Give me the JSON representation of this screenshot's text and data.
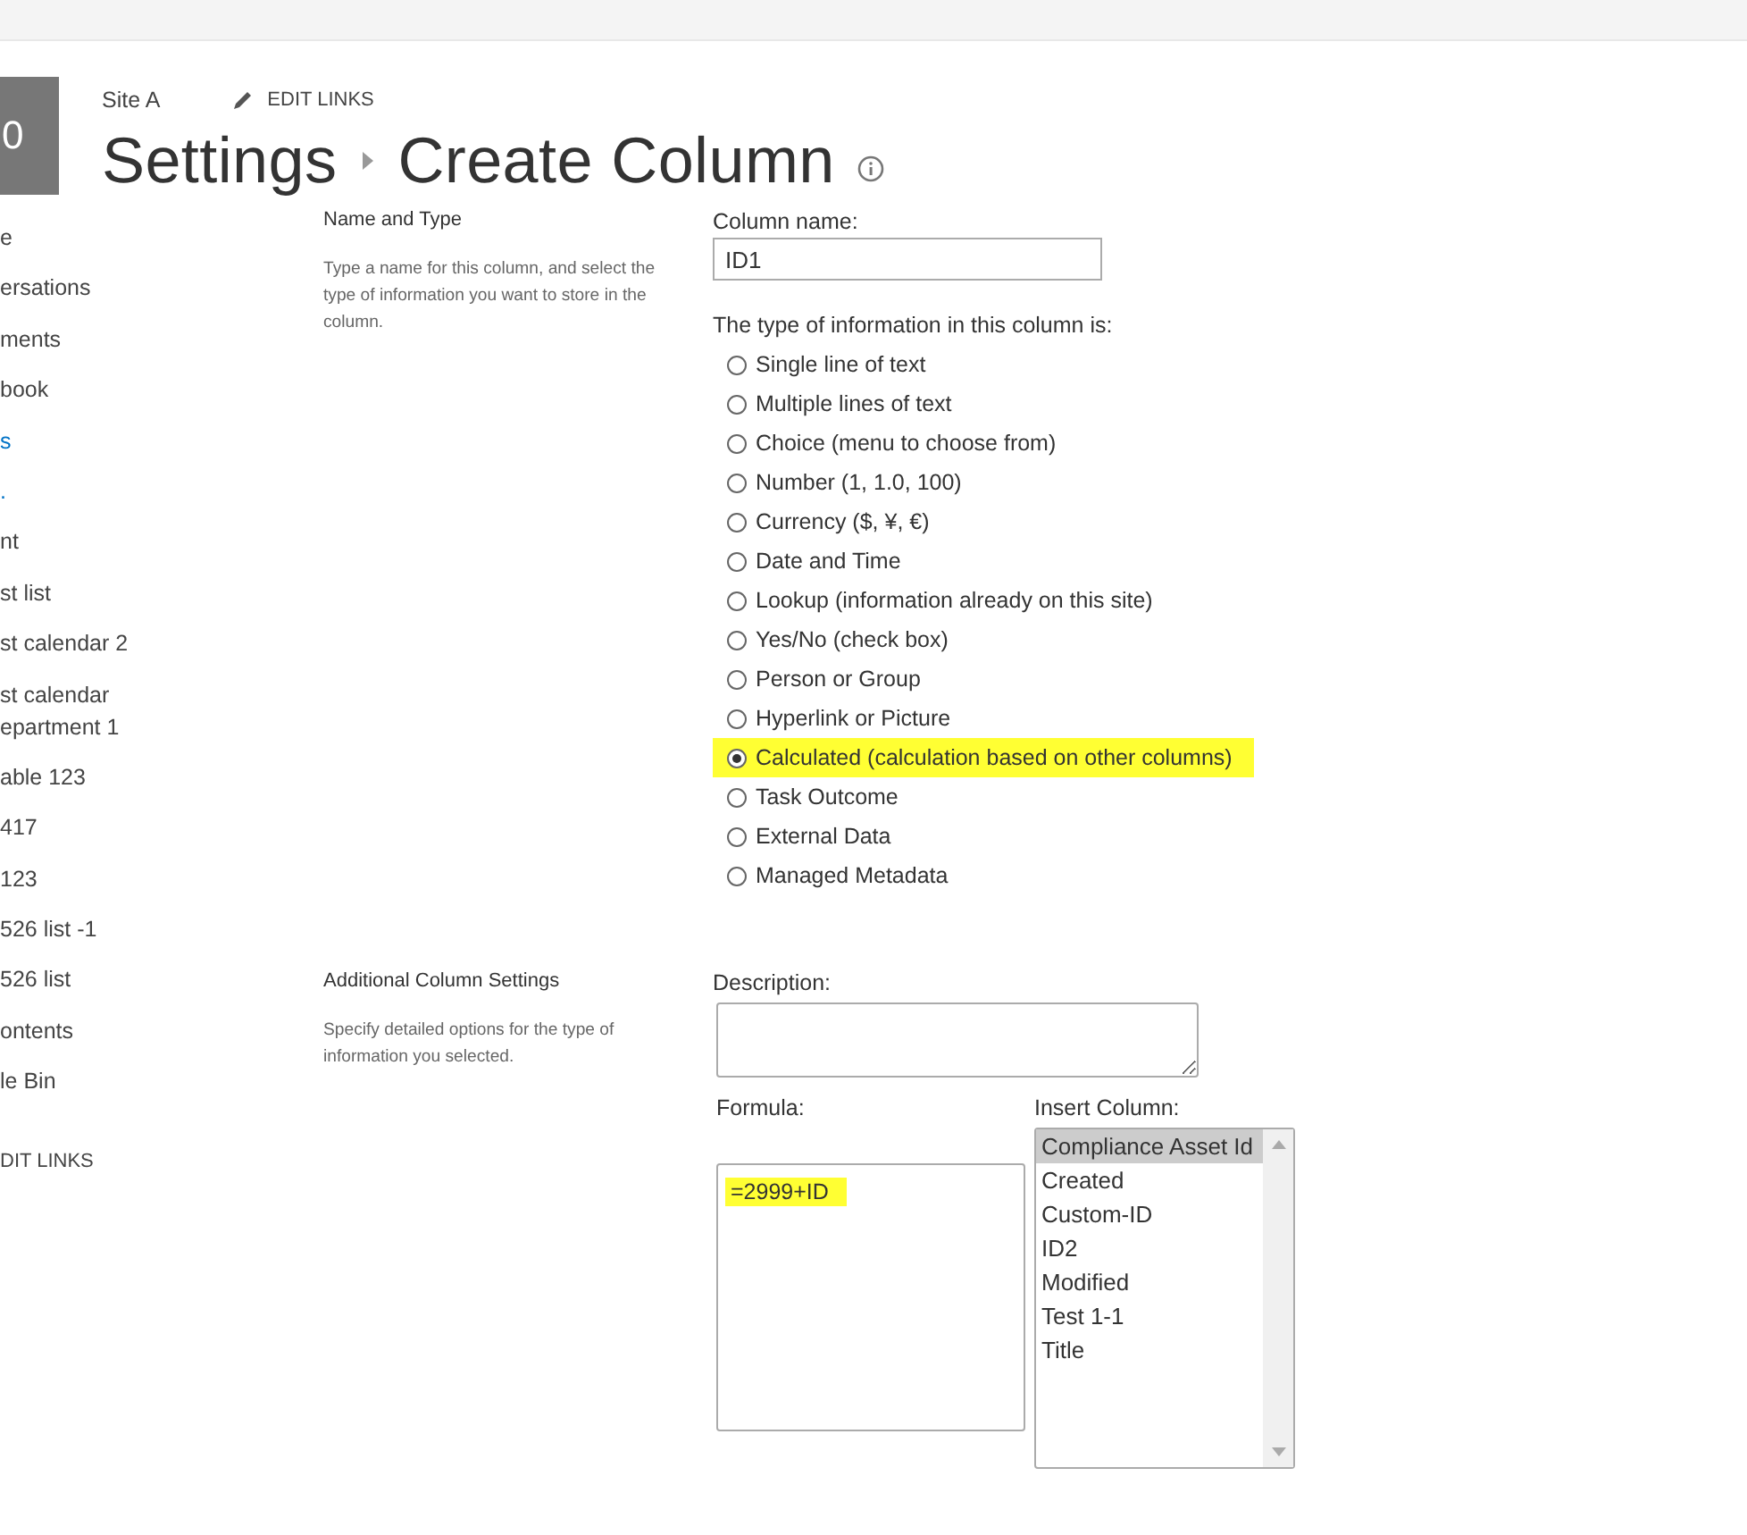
{
  "header": {
    "logo_text": "0",
    "site_name": "Site A",
    "edit_links": "EDIT LINKS",
    "breadcrumb": [
      "Settings",
      "Create Column"
    ]
  },
  "sidebar": {
    "items": [
      {
        "label": "e"
      },
      {
        "label": "ersations"
      },
      {
        "label": "ments"
      },
      {
        "label": "book"
      },
      {
        "label": "s",
        "link": true
      },
      {
        "label": ".",
        "link": true
      },
      {
        "label": "nt"
      },
      {
        "label": "st list"
      },
      {
        "label": "st calendar 2"
      },
      {
        "label": "st calendar\nepartment 1"
      },
      {
        "label": "able 123"
      },
      {
        "label": "417"
      },
      {
        "label": "123"
      },
      {
        "label": "526 list -1"
      },
      {
        "label": "526 list"
      },
      {
        "label": "ontents"
      },
      {
        "label": "le Bin"
      }
    ],
    "edit_links": "DIT LINKS"
  },
  "sections": [
    {
      "kind": "name_type",
      "title": "Name and Type",
      "description": "Type a name for this column, and select the type of information you want to store in the column.",
      "column_name_label": "Column name:",
      "column_name_value": "ID1",
      "type_label": "The type of information in this column is:",
      "options": [
        {
          "label": "Single line of text",
          "selected": false,
          "highlighted": false
        },
        {
          "label": "Multiple lines of text",
          "selected": false,
          "highlighted": false
        },
        {
          "label": "Choice (menu to choose from)",
          "selected": false,
          "highlighted": false
        },
        {
          "label": "Number (1, 1.0, 100)",
          "selected": false,
          "highlighted": false
        },
        {
          "label": "Currency ($, ¥, €)",
          "selected": false,
          "highlighted": false
        },
        {
          "label": "Date and Time",
          "selected": false,
          "highlighted": false
        },
        {
          "label": "Lookup (information already on this site)",
          "selected": false,
          "highlighted": false
        },
        {
          "label": "Yes/No (check box)",
          "selected": false,
          "highlighted": false
        },
        {
          "label": "Person or Group",
          "selected": false,
          "highlighted": false
        },
        {
          "label": "Hyperlink or Picture",
          "selected": false,
          "highlighted": false
        },
        {
          "label": "Calculated (calculation based on other columns)",
          "selected": true,
          "highlighted": true
        },
        {
          "label": "Task Outcome",
          "selected": false,
          "highlighted": false
        },
        {
          "label": "External Data",
          "selected": false,
          "highlighted": false
        },
        {
          "label": "Managed Metadata",
          "selected": false,
          "highlighted": false
        }
      ]
    },
    {
      "kind": "additional",
      "title": "Additional Column Settings",
      "description": "Specify detailed options for the type of information you selected.",
      "description_label": "Description:",
      "formula_label": "Formula:",
      "formula_value": "=2999+ID",
      "formula_highlighted": true,
      "insert_label": "Insert Column:",
      "columns": [
        {
          "label": "Compliance Asset Id",
          "selected": true
        },
        {
          "label": "Created",
          "selected": false
        },
        {
          "label": "Custom-ID",
          "selected": false
        },
        {
          "label": "ID2",
          "selected": false
        },
        {
          "label": "Modified",
          "selected": false
        },
        {
          "label": "Test 1-1",
          "selected": false
        },
        {
          "label": "Title",
          "selected": false
        }
      ]
    }
  ]
}
